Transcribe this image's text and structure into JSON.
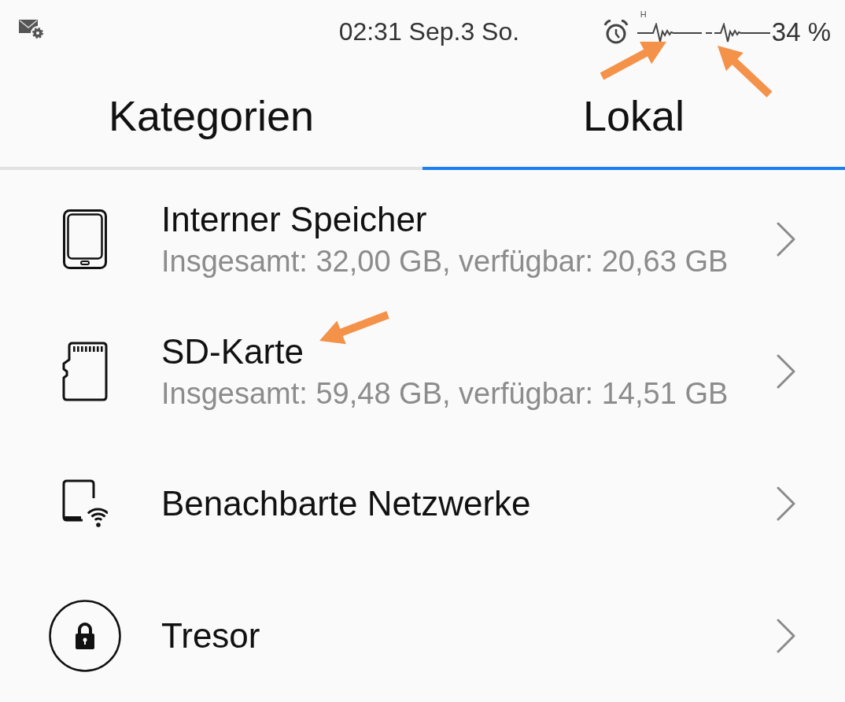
{
  "status_bar": {
    "time": "02:31 Sep.3 So.",
    "network_label": "H",
    "battery": "34 %"
  },
  "tabs": [
    {
      "label": "Kategorien",
      "selected": false
    },
    {
      "label": "Lokal",
      "selected": true
    }
  ],
  "items": [
    {
      "kind": "phone",
      "title": "Interner Speicher",
      "subtitle": "Insgesamt: 32,00 GB, verfügbar: 20,63 GB"
    },
    {
      "kind": "sd-card",
      "title": "SD-Karte",
      "subtitle": "Insgesamt: 59,48 GB, verfügbar: 14,51 GB"
    },
    {
      "kind": "network",
      "title": "Benachbarte Netzwerke"
    },
    {
      "kind": "vault",
      "title": "Tresor"
    }
  ]
}
